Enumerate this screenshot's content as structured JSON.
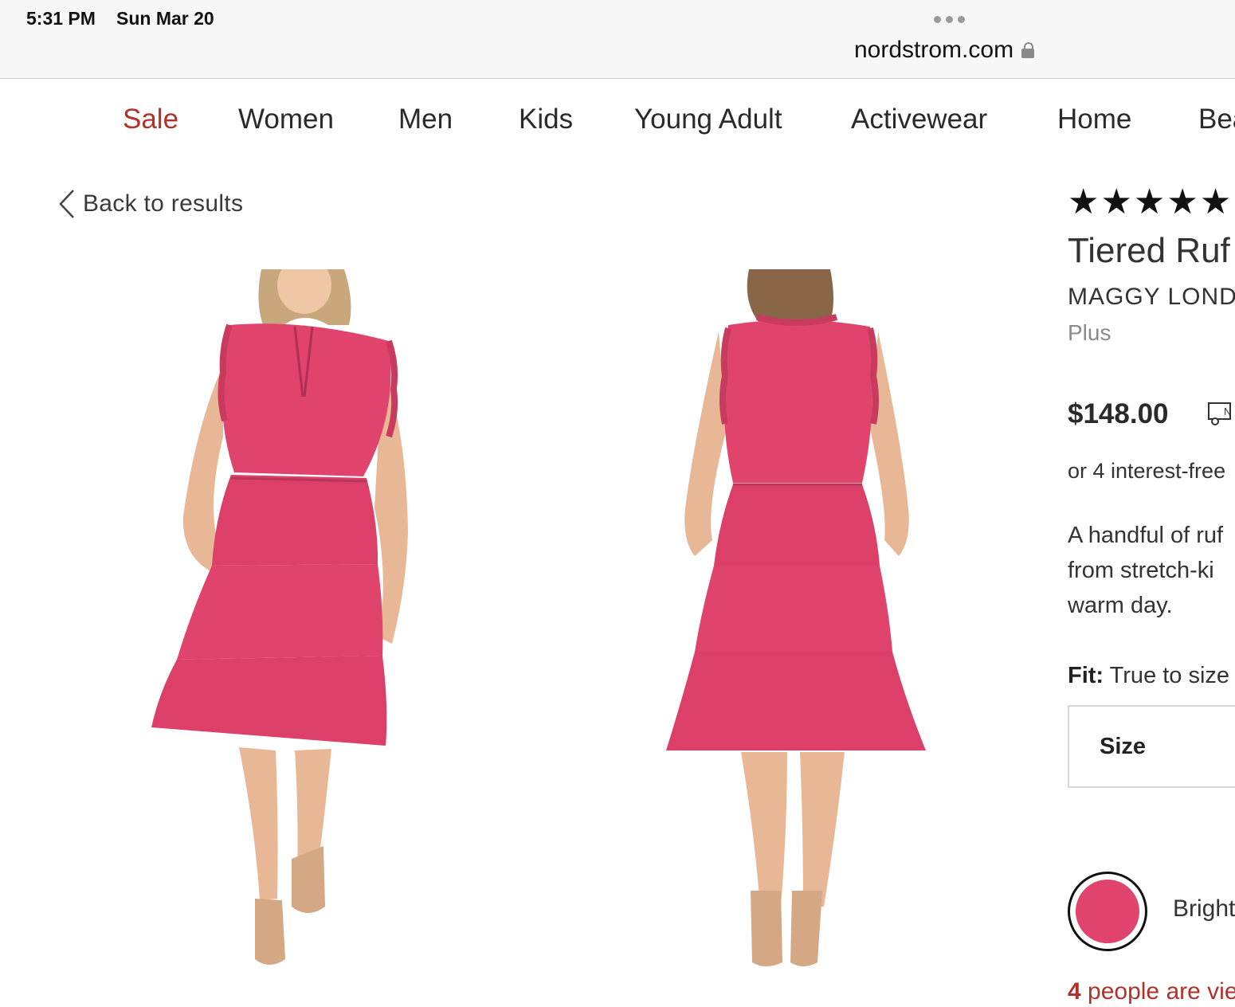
{
  "status": {
    "time": "5:31 PM",
    "date": "Sun Mar 20"
  },
  "browser": {
    "url": "nordstrom.com"
  },
  "nav": {
    "items": [
      "Sale",
      "Women",
      "Men",
      "Kids",
      "Young Adult",
      "Activewear",
      "Home",
      "Bea"
    ]
  },
  "back": {
    "label": "Back to results"
  },
  "product": {
    "rating_stars": 5,
    "reviews_count": "(",
    "title": "Tiered Ruf",
    "brand": "MAGGY LOND",
    "fit_type": "Plus",
    "price": "$148.00",
    "installments": "or 4 interest-free",
    "description": [
      "A handful of ruf",
      "from stretch-ki",
      "warm day."
    ],
    "fit_label": "Fit:",
    "fit_value": "True to size",
    "size_label": "Size",
    "color_name": "Bright",
    "viewers_count": "4",
    "viewers_text": "people are vie"
  },
  "colors": {
    "accent_red": "#b0322a",
    "dress_pink": "#e0446d"
  }
}
